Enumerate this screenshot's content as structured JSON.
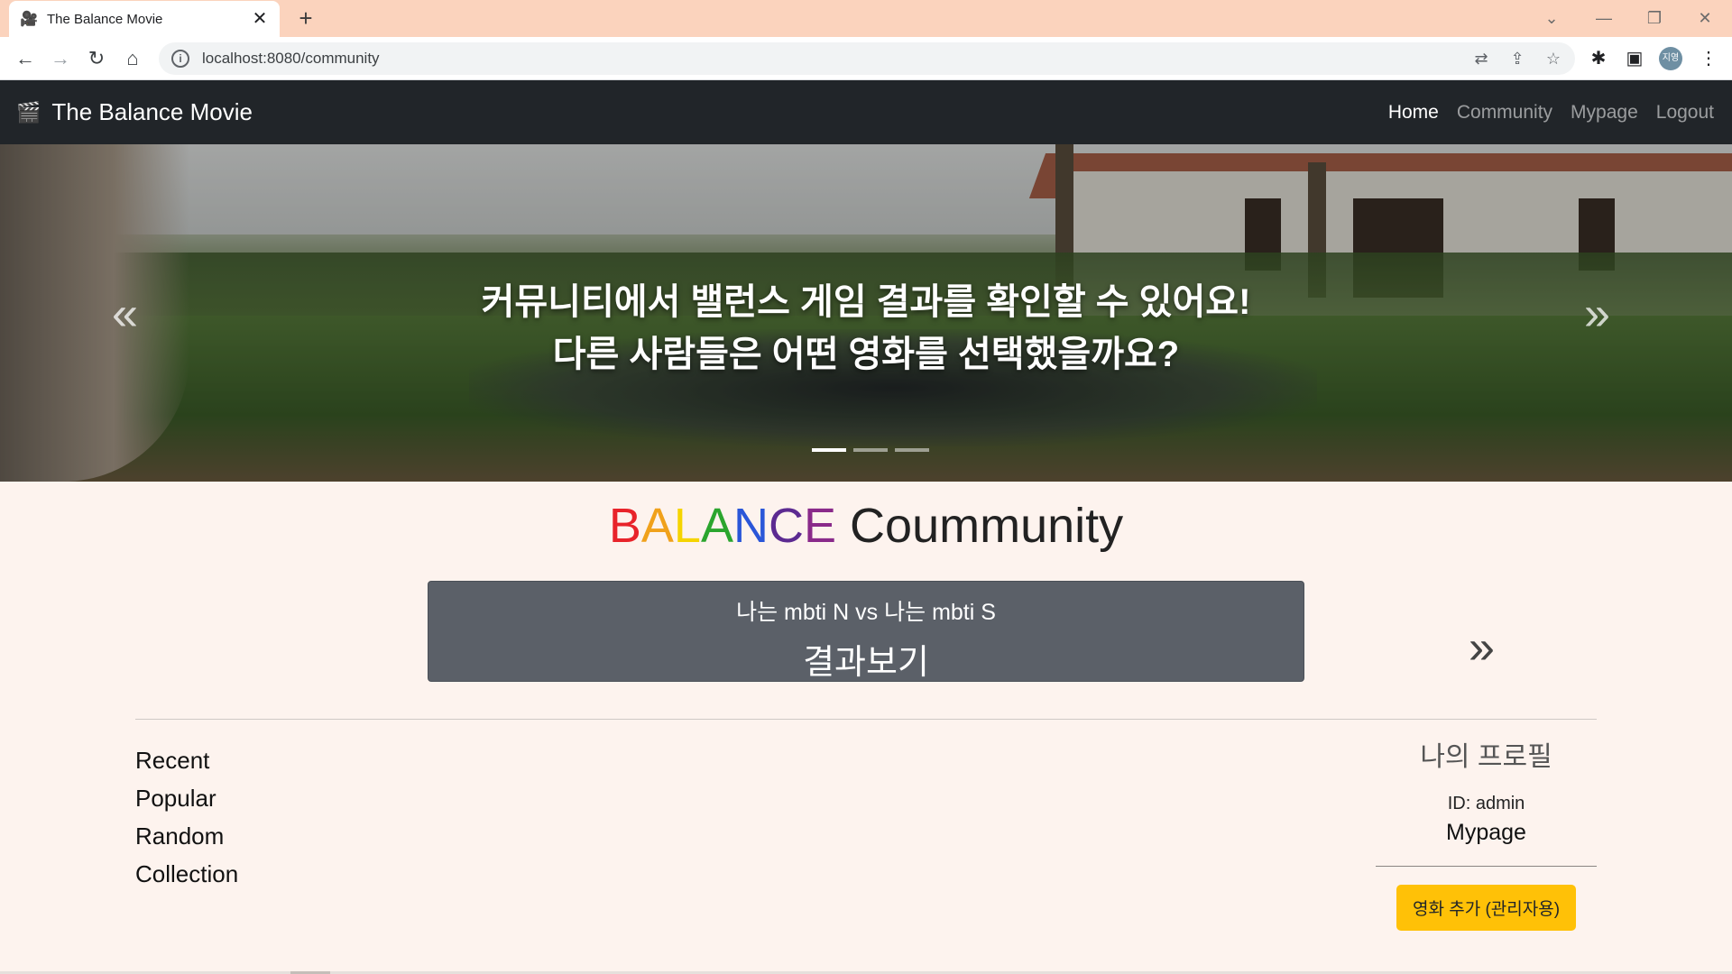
{
  "browser": {
    "tab_title": "The Balance Movie",
    "tab_close": "✕",
    "new_tab": "+",
    "url": "localhost:8080/community",
    "profile_initials": "지영"
  },
  "navbar": {
    "brand": "The Balance Movie",
    "links": [
      "Home",
      "Community",
      "Mypage",
      "Logout"
    ],
    "active": "Home"
  },
  "hero": {
    "caption_line1": "커뮤니티에서 밸런스 게임 결과를 확인할 수 있어요!",
    "caption_line2": "다른 사람들은 어떤 영화를 선택했을까요?",
    "prev": "«",
    "next": "»",
    "slide_count": 3,
    "active_slide": 1
  },
  "community": {
    "title_letters": [
      "B",
      "A",
      "L",
      "A",
      "N",
      "C",
      "E"
    ],
    "title_rest": "Coummunity",
    "game_question": "나는 mbti N vs 나는 mbti S",
    "game_result_label": "결과보기",
    "next_label": "»"
  },
  "sidemenu": [
    "Recent",
    "Popular",
    "Random",
    "Collection"
  ],
  "profile": {
    "title": "나의 프로필",
    "id_text": "ID: admin",
    "mypage_link": "Mypage",
    "admin_button": "영화 추가 (관리자용)"
  },
  "colors": {
    "navbar_bg": "#212529",
    "page_bg": "#fdf3ee",
    "card_bg": "#5b6068",
    "admin_button": "#ffc107",
    "tabstrip": "#fbd3bd"
  }
}
